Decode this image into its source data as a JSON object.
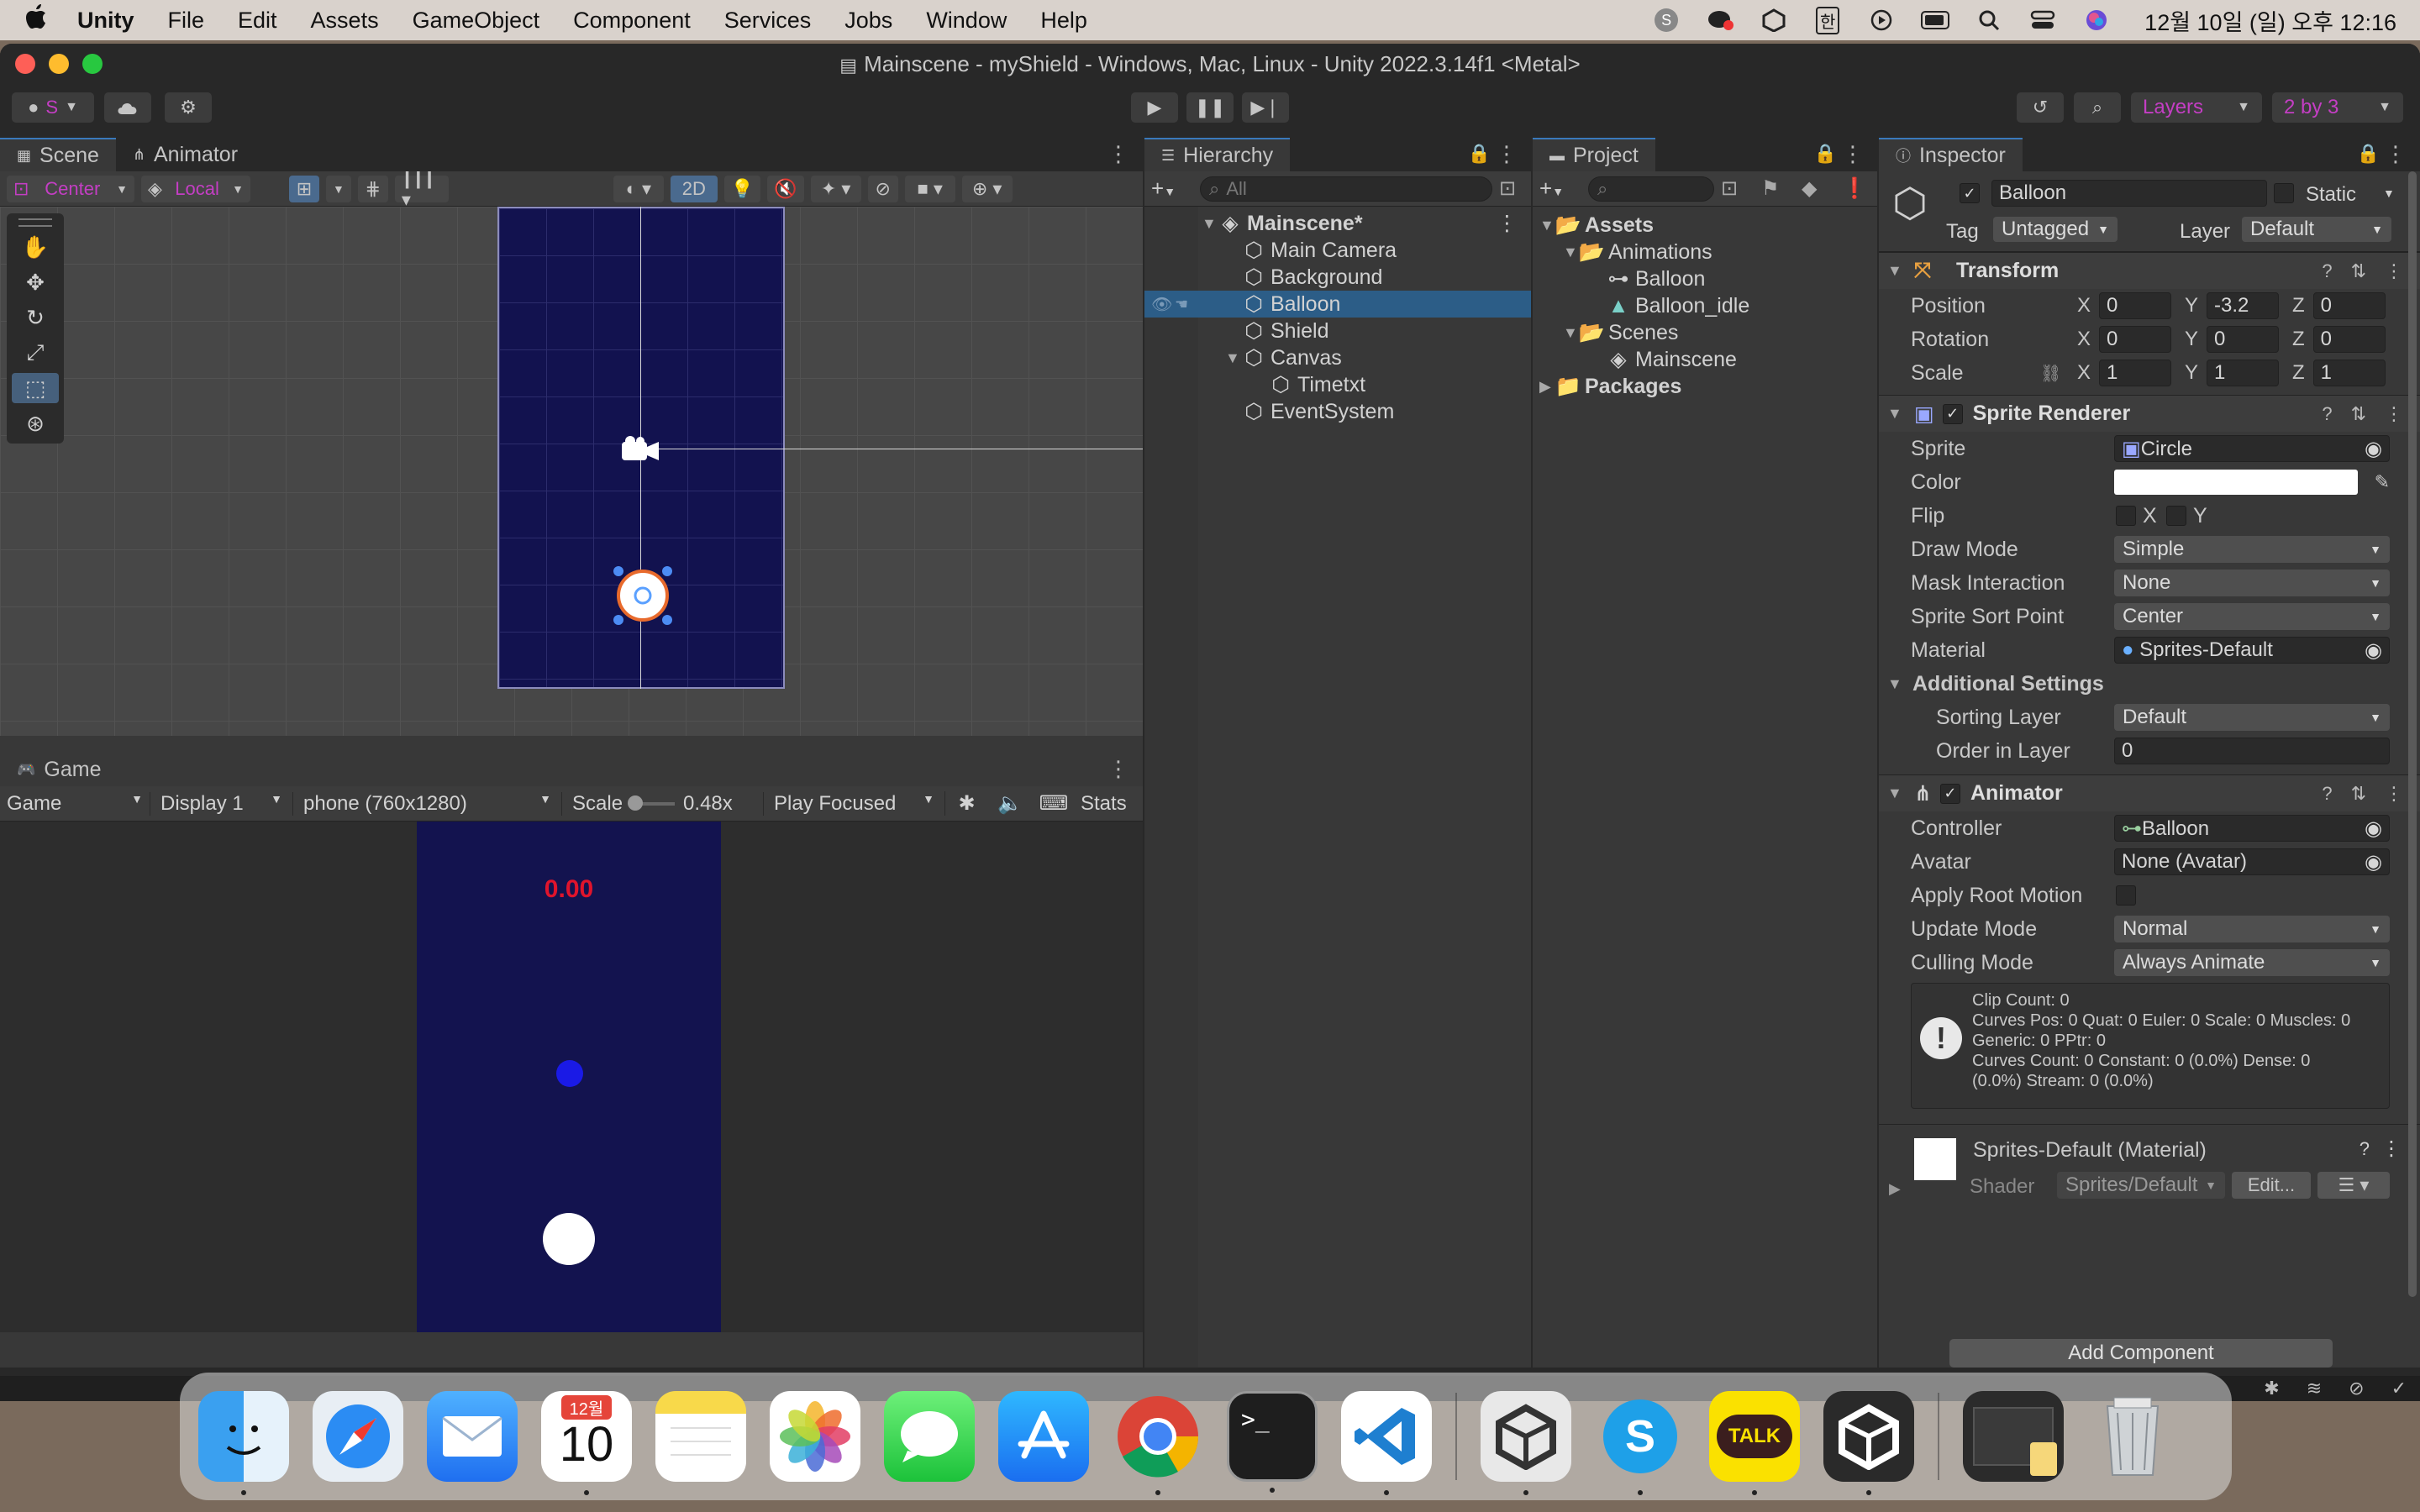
{
  "menubar": {
    "apple_icon": "apple-logo",
    "items": [
      "Unity",
      "File",
      "Edit",
      "Assets",
      "GameObject",
      "Component",
      "Services",
      "Jobs",
      "Window",
      "Help"
    ],
    "ime": "한",
    "clock": "12월 10일 (일) 오후 12:16"
  },
  "window": {
    "title": "Mainscene - myShield - Windows, Mac, Linux - Unity 2022.3.14f1 <Metal>"
  },
  "toolbar": {
    "account_label": "S",
    "layers_label": "Layers",
    "layout_label": "2 by 3"
  },
  "scene_panel": {
    "tabs": [
      "Scene",
      "Animator"
    ],
    "pivot_label": "Center",
    "space_label": "Local",
    "mode_2d": "2D"
  },
  "game_panel": {
    "tab": "Game",
    "mode": "Game",
    "display": "Display 1",
    "resolution": "phone (760x1280)",
    "scale_label": "Scale",
    "scale_value": "0.48x",
    "play_mode": "Play Focused",
    "stats": "Stats",
    "timer_text": "0.00",
    "timer_color": "#e0142c"
  },
  "hierarchy": {
    "tab": "Hierarchy",
    "search_placeholder": "All",
    "scene_name": "Mainscene*",
    "items": [
      "Main Camera",
      "Background",
      "Balloon",
      "Shield",
      "Canvas",
      "Timetxt",
      "EventSystem"
    ],
    "selected": "Balloon"
  },
  "project": {
    "tab": "Project",
    "assets": "Assets",
    "animations": "Animations",
    "anim_items": [
      "Balloon",
      "Balloon_idle"
    ],
    "scenes": "Scenes",
    "scene_items": [
      "Mainscene"
    ],
    "packages": "Packages"
  },
  "inspector": {
    "tab": "Inspector",
    "object_name": "Balloon",
    "static_label": "Static",
    "tag_label": "Tag",
    "tag_value": "Untagged",
    "layer_label": "Layer",
    "layer_value": "Default",
    "transform": {
      "title": "Transform",
      "position_label": "Position",
      "position": [
        "0",
        "-3.2",
        "0"
      ],
      "rotation_label": "Rotation",
      "rotation": [
        "0",
        "0",
        "0"
      ],
      "scale_label": "Scale",
      "scale": [
        "1",
        "1",
        "1"
      ]
    },
    "sprite_renderer": {
      "title": "Sprite Renderer",
      "sprite_label": "Sprite",
      "sprite_value": "Circle",
      "color_label": "Color",
      "color_value": "#ffffff",
      "flip_label": "Flip",
      "flip_x": "X",
      "flip_y": "Y",
      "draw_mode_label": "Draw Mode",
      "draw_mode_value": "Simple",
      "mask_label": "Mask Interaction",
      "mask_value": "None",
      "sort_point_label": "Sprite Sort Point",
      "sort_point_value": "Center",
      "material_label": "Material",
      "material_value": "Sprites-Default",
      "additional_label": "Additional Settings",
      "sorting_layer_label": "Sorting Layer",
      "sorting_layer_value": "Default",
      "order_label": "Order in Layer",
      "order_value": "0"
    },
    "animator": {
      "title": "Animator",
      "controller_label": "Controller",
      "controller_value": "Balloon",
      "avatar_label": "Avatar",
      "avatar_value": "None (Avatar)",
      "root_motion_label": "Apply Root Motion",
      "update_label": "Update Mode",
      "update_value": "Normal",
      "culling_label": "Culling Mode",
      "culling_value": "Always Animate",
      "info_lines": [
        "Clip Count: 0",
        "Curves Pos: 0 Quat: 0 Euler: 0 Scale: 0 Muscles: 0",
        "Generic: 0 PPtr: 0",
        "Curves Count: 0 Constant: 0 (0.0%) Dense: 0",
        "(0.0%) Stream: 0 (0.0%)"
      ]
    },
    "material": {
      "title": "Sprites-Default (Material)",
      "shader_label": "Shader",
      "shader_value": "Sprites/Default",
      "edit_label": "Edit..."
    },
    "add_component": "Add Component"
  },
  "dock": {
    "calendar_month": "12월",
    "calendar_day": "10",
    "apps": [
      "finder-icon",
      "safari-icon",
      "mail-icon",
      "calendar-icon",
      "notes-icon",
      "photos-icon",
      "messages-icon",
      "appstore-icon",
      "chrome-icon",
      "terminal-icon",
      "vscode-icon",
      "unity-hub-icon",
      "skype-icon",
      "kakaotalk-icon",
      "unity-icon",
      "downloads-stack-icon",
      "trash-icon"
    ],
    "kakao_label": "TALK"
  },
  "colors": {
    "accent_blue": "#2c5d87",
    "camera_bg": "#12124f",
    "ball_blue": "#1a1ae6"
  }
}
